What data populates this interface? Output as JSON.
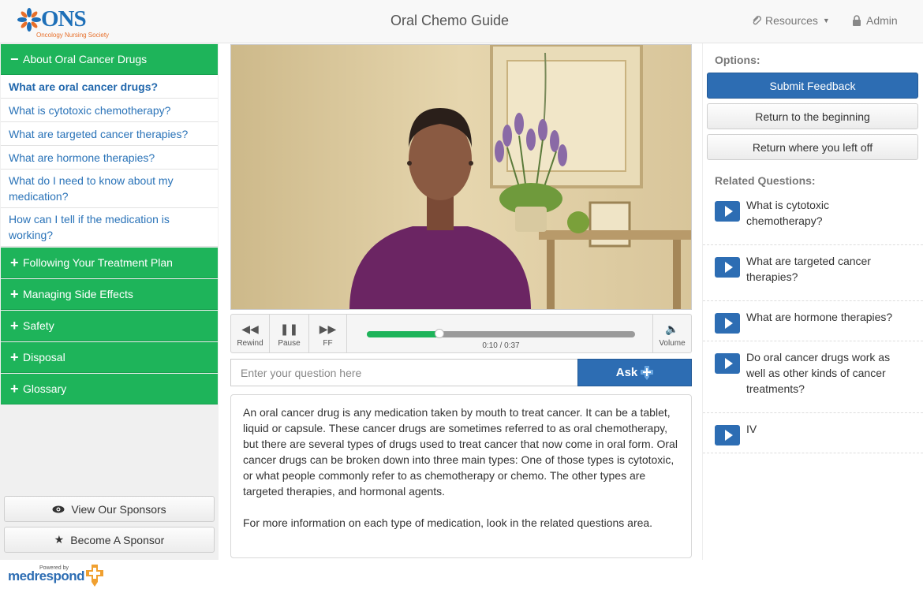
{
  "header": {
    "logo_text": "ONS",
    "logo_subtext": "Oncology Nursing Society",
    "title": "Oral Chemo Guide",
    "resources_label": "Resources",
    "admin_label": "Admin"
  },
  "sidebar": {
    "sections": [
      {
        "label": "About Oral Cancer Drugs",
        "expanded": true
      },
      {
        "label": "Following Your Treatment Plan"
      },
      {
        "label": "Managing Side Effects"
      },
      {
        "label": "Safety"
      },
      {
        "label": "Disposal"
      },
      {
        "label": "Glossary"
      }
    ],
    "items": [
      {
        "label": "What are oral cancer drugs?",
        "active": true
      },
      {
        "label": "What is cytotoxic chemotherapy?"
      },
      {
        "label": "What are targeted cancer therapies?"
      },
      {
        "label": "What are hormone therapies?"
      },
      {
        "label": "What do I need to know about my medication?"
      },
      {
        "label": "How can I tell if the medication is working?"
      }
    ],
    "view_sponsors_label": "View Our Sponsors",
    "become_sponsor_label": "Become A Sponsor",
    "footer_powered": "Powered by",
    "footer_brand": "medrespond"
  },
  "player": {
    "rewind_label": "Rewind",
    "pause_label": "Pause",
    "ff_label": "FF",
    "volume_label": "Volume",
    "time": "0:10 / 0:37",
    "progress": 0.27
  },
  "ask": {
    "placeholder": "Enter your question here",
    "button_label": "Ask"
  },
  "answer": {
    "paragraph1": "An oral cancer drug is any medication taken by mouth to treat cancer. It can be a tablet, liquid or capsule. These cancer drugs are sometimes referred to as oral chemotherapy, but there are several types of drugs used to treat cancer that now come in oral form. Oral cancer drugs can be broken down into three main types: One of those types is cytotoxic, or what people commonly refer to as chemotherapy or chemo. The other types are targeted therapies, and hormonal agents.",
    "paragraph2": "For more information on each type of medication, look in the related questions area."
  },
  "options": {
    "label": "Options:",
    "submit_feedback": "Submit Feedback",
    "return_beginning": "Return to the beginning",
    "return_left_off": "Return where you left off"
  },
  "related": {
    "label": "Related Questions:",
    "items": [
      "What is cytotoxic chemotherapy?",
      "What are targeted cancer therapies?",
      "What are hormone therapies?",
      "Do oral cancer drugs work as well as other kinds of cancer treatments?",
      "IV"
    ]
  },
  "colors": {
    "accent_green": "#1eb45a",
    "primary_blue": "#2d6db3",
    "link_blue": "#2a73b8"
  }
}
